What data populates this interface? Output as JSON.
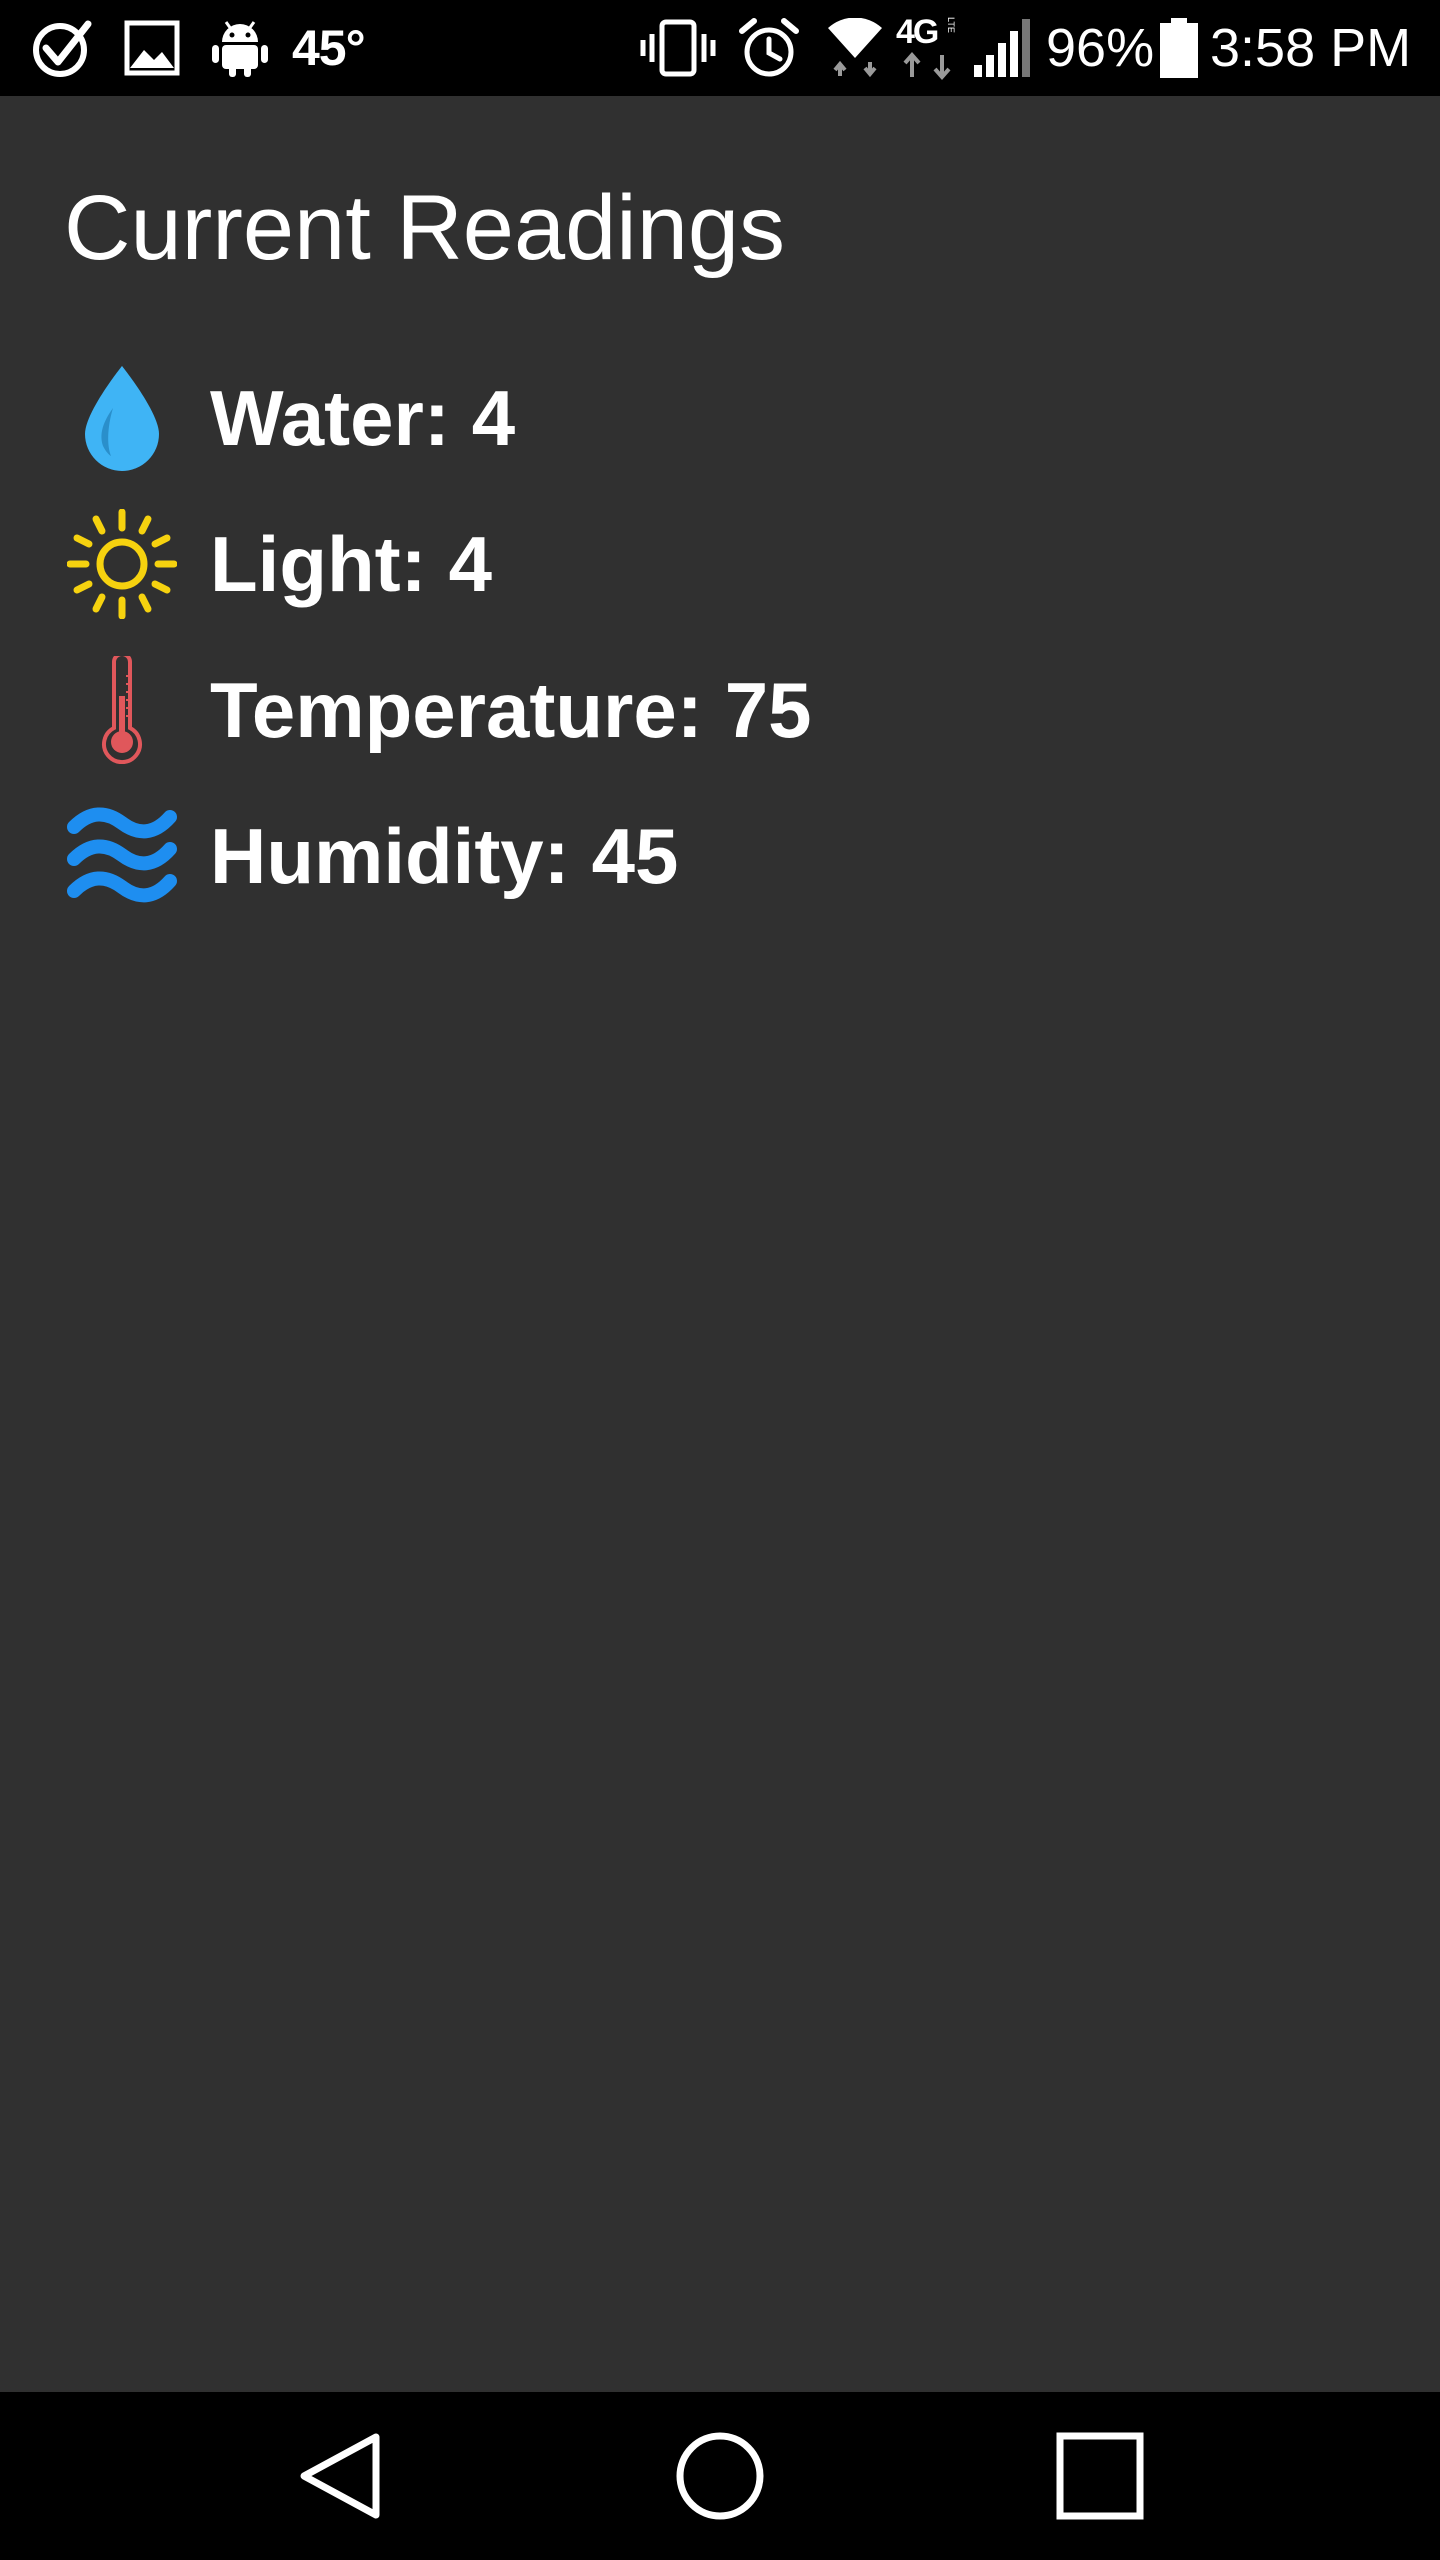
{
  "status_bar": {
    "temperature": "45°",
    "battery_percent": "96%",
    "time": "3:58 PM",
    "network": "4G",
    "network_sub": "LTE",
    "icons": [
      "check-circle-icon",
      "image-icon",
      "android-icon",
      "vibrate-icon",
      "alarm-icon",
      "wifi-icon",
      "signal-icon",
      "battery-icon"
    ],
    "battery_level": 0.96
  },
  "main": {
    "title": "Current Readings",
    "readings": [
      {
        "label": "Water:",
        "value": "4",
        "icon": "water-drop-icon",
        "color": "#3fb4f5"
      },
      {
        "label": "Light:",
        "value": "4",
        "icon": "sun-icon",
        "color": "#f6d20f"
      },
      {
        "label": "Temperature:",
        "value": "75",
        "icon": "thermometer-icon",
        "color": "#e0575b"
      },
      {
        "label": "Humidity:",
        "value": "45",
        "icon": "humidity-waves-icon",
        "color": "#1e8ef0"
      }
    ]
  },
  "nav_bar": {
    "buttons": [
      "back-icon",
      "home-icon",
      "recents-icon"
    ]
  },
  "colors": {
    "background": "#303030",
    "bars": "#000000",
    "text": "#ffffff"
  }
}
